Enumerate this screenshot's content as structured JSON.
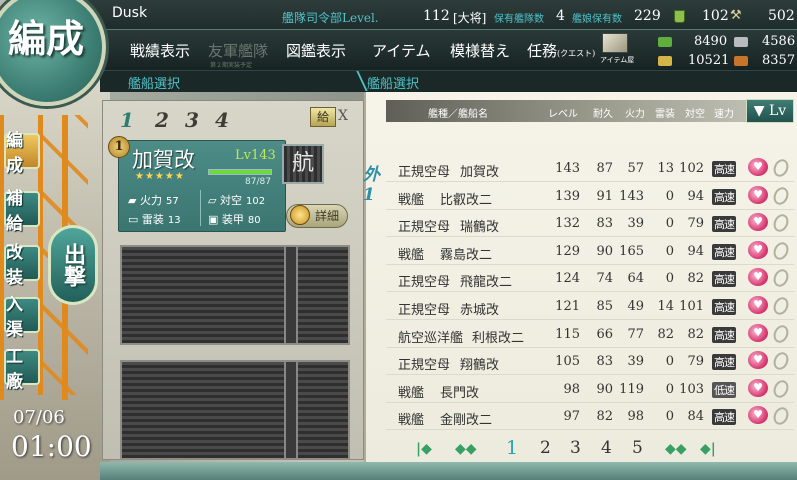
{
  "topbar": {
    "player_name": "Dusk",
    "hq_label": "艦隊司令部Level.",
    "hq_level": "112",
    "rank": "[大将]",
    "ships_label": "保有艦隊数",
    "ships_count": "4",
    "girls_label": "艦娘保有数",
    "girls_count": "229",
    "buckets": "102",
    "devmats": "502"
  },
  "menu": {
    "items": [
      "戦績表示",
      "友軍艦隊",
      "図鑑表示",
      "アイテム",
      "模様替え",
      "任務"
    ],
    "friend_fleet_sub": "第２期実装予定",
    "quest_sub": "(クエスト)",
    "shop_label": "アイテム屋"
  },
  "resources": {
    "fuel": "8490",
    "steel": "4586",
    "ammo": "10521",
    "bauxite": "8357"
  },
  "breadcrumb": {
    "left": "艦船選択",
    "right": "艦船選択"
  },
  "nav": {
    "logo": "編成",
    "items": [
      "編成",
      "補給",
      "改装",
      "入渠",
      "工廠"
    ],
    "sortie": "出撃"
  },
  "clock": {
    "date": "07/06",
    "time": "01:00"
  },
  "fleet": {
    "tabs": [
      "1",
      "2",
      "3",
      "4"
    ],
    "supply_label": "給",
    "close_label": "X",
    "slot_number": "1",
    "ship": {
      "name": "加賀改",
      "level": "Lv143",
      "stars": "★★★★★",
      "hp": "87/87",
      "hp_fraction": 1.0,
      "type_badge": "航",
      "firepower_label": "火力",
      "firepower": "57",
      "aa_label": "対空",
      "aa": "102",
      "torpedo_label": "雷装",
      "torpedo": "13",
      "armor_label": "装甲",
      "armor": "80"
    },
    "detail_label": "詳細"
  },
  "list": {
    "headers": {
      "type_name": "艦種／艦船名",
      "level": "レベル",
      "hp": "耐久",
      "firepower": "火力",
      "torpedo": "雷装",
      "aa": "対空",
      "speed": "速力"
    },
    "sort_label": "▼ Lv",
    "fleet_mark": "外1",
    "rows": [
      {
        "type": "正規空母",
        "name": "加賀改",
        "level": "143",
        "hp": "87",
        "fp": "57",
        "tp": "13",
        "aa": "102",
        "speed": "高速"
      },
      {
        "type": "戦艦",
        "name": "比叡改二",
        "level": "139",
        "hp": "91",
        "fp": "143",
        "tp": "0",
        "aa": "94",
        "speed": "高速"
      },
      {
        "type": "正規空母",
        "name": "瑞鶴改",
        "level": "132",
        "hp": "83",
        "fp": "39",
        "tp": "0",
        "aa": "79",
        "speed": "高速"
      },
      {
        "type": "戦艦",
        "name": "霧島改二",
        "level": "129",
        "hp": "90",
        "fp": "165",
        "tp": "0",
        "aa": "94",
        "speed": "高速"
      },
      {
        "type": "正規空母",
        "name": "飛龍改二",
        "level": "124",
        "hp": "74",
        "fp": "64",
        "tp": "0",
        "aa": "82",
        "speed": "高速"
      },
      {
        "type": "正規空母",
        "name": "赤城改",
        "level": "121",
        "hp": "85",
        "fp": "49",
        "tp": "14",
        "aa": "101",
        "speed": "高速"
      },
      {
        "type": "航空巡洋艦",
        "name": "利根改二",
        "level": "115",
        "hp": "66",
        "fp": "77",
        "tp": "82",
        "aa": "82",
        "speed": "高速"
      },
      {
        "type": "正規空母",
        "name": "翔鶴改",
        "level": "105",
        "hp": "83",
        "fp": "39",
        "tp": "0",
        "aa": "79",
        "speed": "高速"
      },
      {
        "type": "戦艦",
        "name": "長門改",
        "level": "98",
        "hp": "90",
        "fp": "119",
        "tp": "0",
        "aa": "103",
        "speed": "低速"
      },
      {
        "type": "戦艦",
        "name": "金剛改二",
        "level": "97",
        "hp": "82",
        "fp": "98",
        "tp": "0",
        "aa": "84",
        "speed": "高速"
      }
    ],
    "heart_glyph": "♥",
    "pages": [
      "1",
      "2",
      "3",
      "4",
      "5"
    ],
    "current_page": "1",
    "first_arrow": "|◆",
    "prev_arrow": "◆◆",
    "next_arrow": "◆◆",
    "last_arrow": "◆|"
  }
}
